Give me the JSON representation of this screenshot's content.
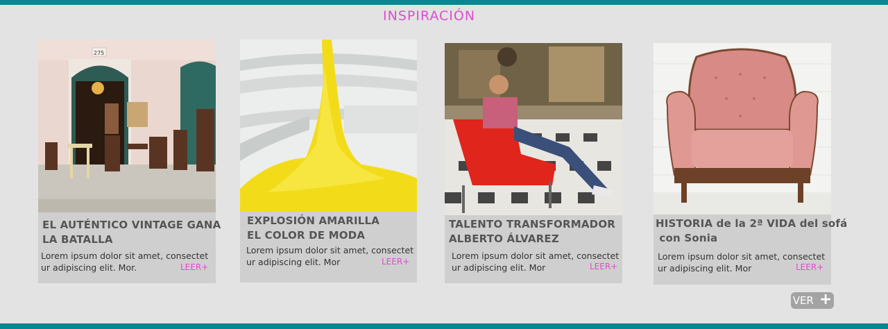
{
  "section": {
    "title": "INSPIRACIÓN"
  },
  "cards": [
    {
      "title_lines": [
        "EL AUTÉNTICO VINTAGE GANA",
        "LA BATALLA"
      ],
      "text_lines": [
        "Lorem ipsum dolor sit amet, consectet",
        "ur adipiscing elit. Mor."
      ],
      "more": "LEER+",
      "image": "vintage-shop-street-image",
      "house_number": "275"
    },
    {
      "title_lines": [
        "EXPLOSIÓN AMARILLA",
        "EL COLOR DE MODA"
      ],
      "text_lines": [
        "Lorem ipsum dolor sit amet, consectet",
        "ur adipiscing elit. Mor"
      ],
      "more": "LEER+",
      "image": "yellow-paint-explosion-image"
    },
    {
      "title_lines": [
        "TALENTO TRANSFORMADOR",
        "ALBERTO ÁLVAREZ"
      ],
      "text_lines": [
        "Lorem ipsum dolor sit amet, consectet",
        "ur adipiscing elit. Mor"
      ],
      "more": "LEER+",
      "image": "man-in-red-chair-image"
    },
    {
      "title_lines": [
        "HISTORIA de la 2ª VIDA del sofá",
        " con Sonia"
      ],
      "text_lines": [
        "Lorem ipsum dolor sit amet, consectet",
        "ur adipiscing elit. Mor"
      ],
      "more": "LEER+",
      "image": "pink-armchair-image"
    }
  ],
  "ver_button": {
    "label": "VER",
    "icon": "plus-icon"
  },
  "colors": {
    "accent": "#e04bd0",
    "teal": "#0b8591",
    "card_bg": "#cfcfcf",
    "page_bg": "#e3e3e3"
  }
}
